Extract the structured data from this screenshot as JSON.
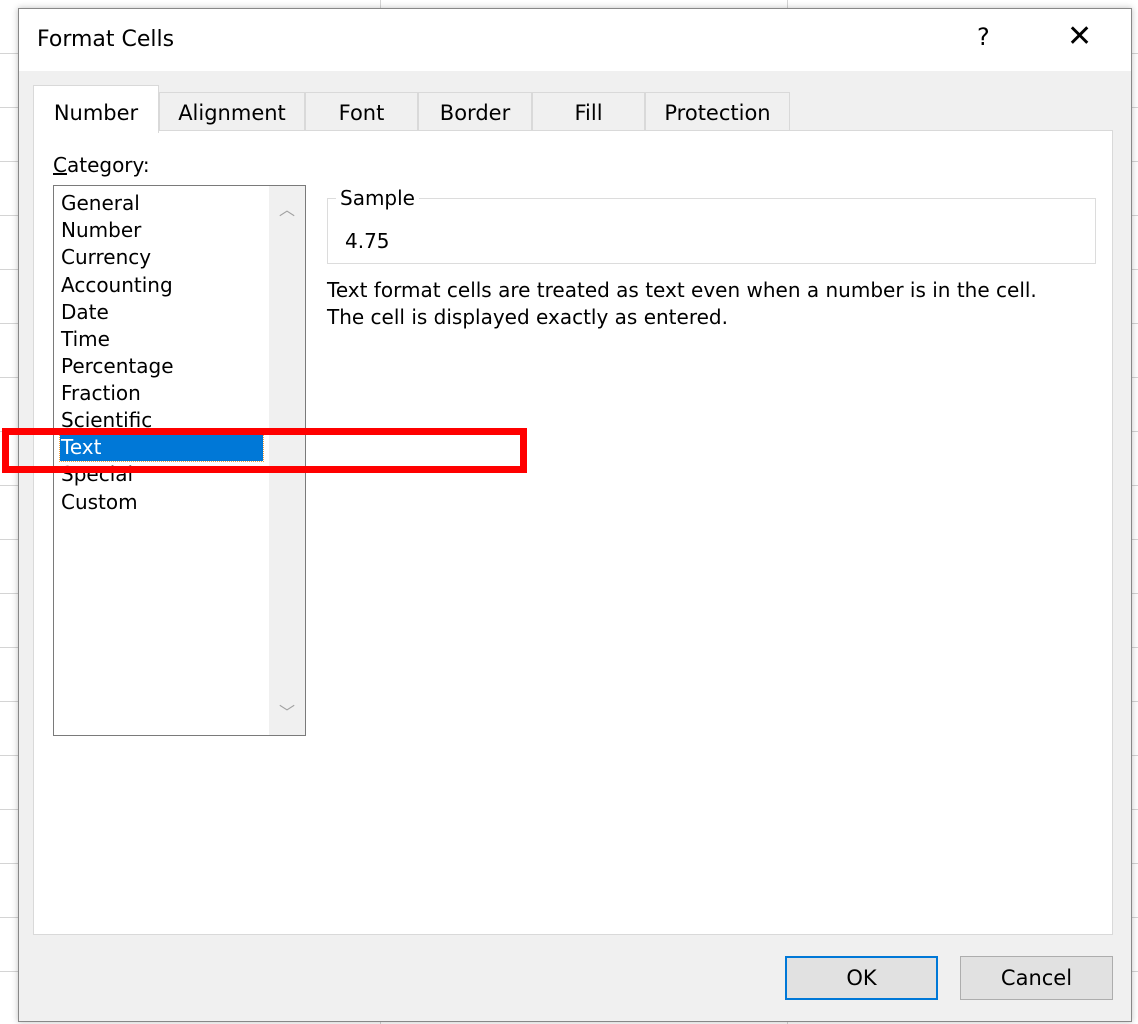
{
  "dialog": {
    "title": "Format Cells",
    "help_label": "?",
    "close_label": "✕"
  },
  "tabs": [
    {
      "label": "Number",
      "active": true
    },
    {
      "label": "Alignment"
    },
    {
      "label": "Font"
    },
    {
      "label": "Border"
    },
    {
      "label": "Fill"
    },
    {
      "label": "Protection"
    }
  ],
  "category": {
    "label": "Category:",
    "items": [
      "General",
      "Number",
      "Currency",
      "Accounting",
      "Date",
      "Time",
      "Percentage",
      "Fraction",
      "Scientific",
      "Text",
      "Special",
      "Custom"
    ],
    "selected": "Text"
  },
  "sample": {
    "label": "Sample",
    "value": "4.75"
  },
  "description": [
    "Text format cells are treated as text even when a number is in the cell.",
    "The cell is displayed exactly as entered."
  ],
  "buttons": {
    "ok": "OK",
    "cancel": "Cancel"
  },
  "colors": {
    "selection": "#0078d7",
    "highlight_box": "#ff0000"
  }
}
